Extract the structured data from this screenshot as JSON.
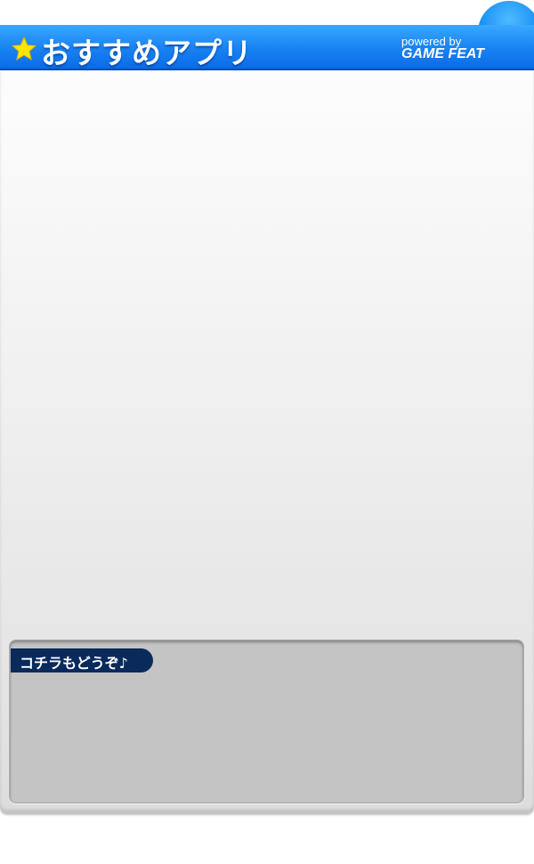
{
  "header": {
    "title": "おすすめアプリ",
    "powered_by": "powered by",
    "brand": "GAME FEAT",
    "star_icon": "star-icon"
  },
  "sub_section": {
    "label": "コチラもどうぞ♪"
  },
  "colors": {
    "header_blue": "#1a85f4",
    "star_yellow": "#ffe600",
    "tab_navy": "#0b2a5c",
    "sub_box_gray": "#c4c4c4"
  }
}
